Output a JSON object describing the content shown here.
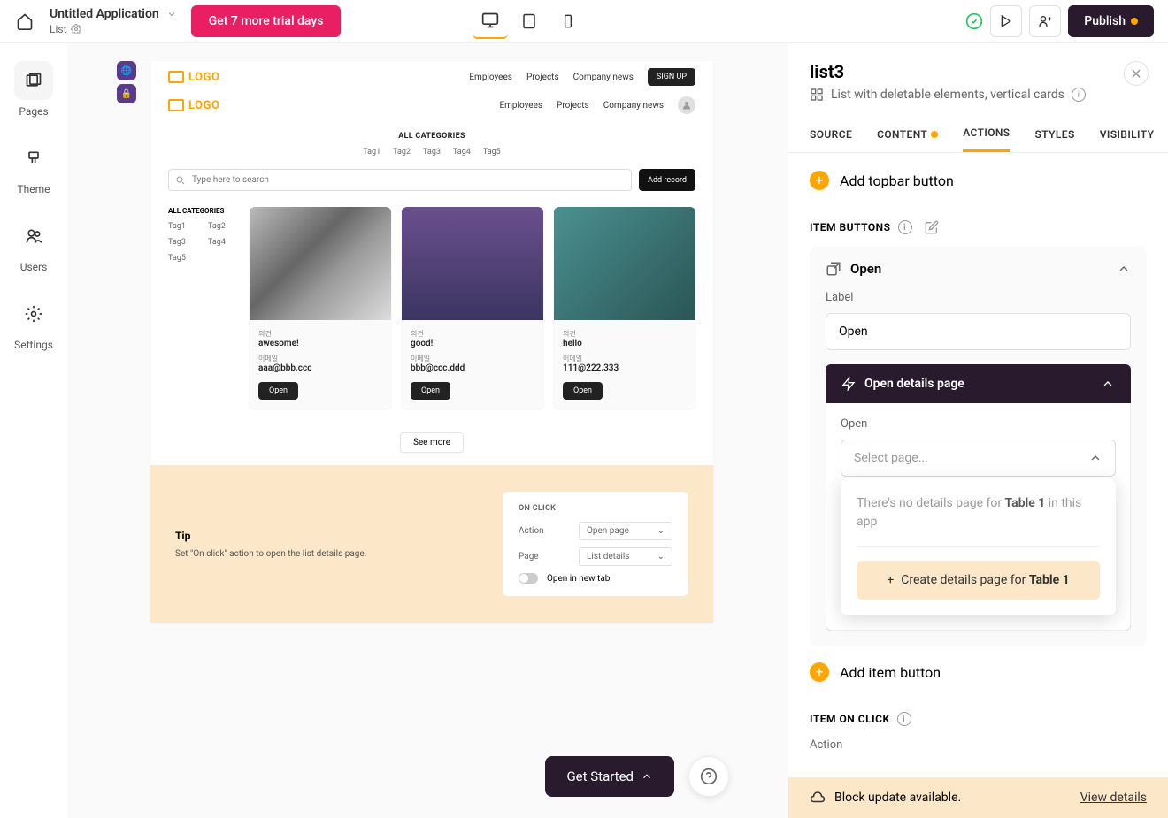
{
  "topbar": {
    "app_title": "Untitled Application",
    "subtitle": "List",
    "trial_btn": "Get 7 more trial days",
    "publish": "Publish"
  },
  "left_nav": {
    "pages": "Pages",
    "theme": "Theme",
    "users": "Users",
    "settings": "Settings"
  },
  "preview": {
    "logo": "LOGO",
    "nav1": [
      "Employees",
      "Projects",
      "Company news"
    ],
    "signup": "SIGN UP",
    "nav2": [
      "Employees",
      "Projects",
      "Company news"
    ],
    "all_categories": "ALL CATEGORIES",
    "tags": [
      "Tag1",
      "Tag2",
      "Tag3",
      "Tag4",
      "Tag5"
    ],
    "search_placeholder": "Type here to search",
    "add_record": "Add record",
    "side_cat_title": "ALL CATEGORIES",
    "cards": [
      {
        "label1": "의견",
        "v1": "awesome!",
        "label2": "이메일",
        "v2": "aaa@bbb.ccc",
        "open": "Open"
      },
      {
        "label1": "의견",
        "v1": "good!",
        "label2": "이메일",
        "v2": "bbb@ccc.ddd",
        "open": "Open"
      },
      {
        "label1": "의견",
        "v1": "hello",
        "label2": "이메일",
        "v2": "111@222.333",
        "open": "Open"
      }
    ],
    "see_more": "See more",
    "tip_title": "Tip",
    "tip_desc": "Set \"On click\" action to open the list details page.",
    "tip_onclick": "ON CLICK",
    "tip_action_label": "Action",
    "tip_action_value": "Open page",
    "tip_page_label": "Page",
    "tip_page_value": "List details",
    "tip_toggle_label": "Open in new tab"
  },
  "float": {
    "get_started": "Get Started"
  },
  "panel": {
    "title": "list3",
    "subtitle": "List with deletable elements, vertical cards",
    "tabs": {
      "source": "SOURCE",
      "content": "CONTENT",
      "actions": "ACTIONS",
      "styles": "STYLES",
      "visibility": "VISIBILITY"
    },
    "add_topbar": "Add topbar button",
    "item_buttons": "ITEM BUTTONS",
    "open_head": "Open",
    "label_text": "Label",
    "label_value": "Open",
    "open_details_head": "Open details page",
    "open_label2": "Open",
    "select_placeholder": "Select page...",
    "dropdown_msg_pre": "There's no details page for ",
    "dropdown_msg_bold": "Table 1",
    "dropdown_msg_post": " in this app",
    "create_details": "Create details page for ",
    "create_details_bold": "Table 1",
    "add_item": "Add item button",
    "item_on_click": "ITEM ON CLICK",
    "action_label": "Action"
  },
  "footer": {
    "msg": "Block update available.",
    "link": "View details"
  }
}
